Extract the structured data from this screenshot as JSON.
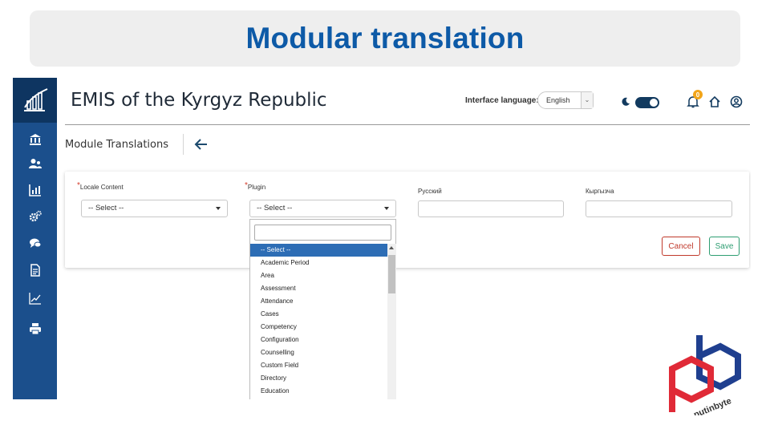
{
  "banner": {
    "title": "Modular translation"
  },
  "app": {
    "title": "EMIS of the Kyrgyz Republic",
    "sidebar": {
      "logo_icon": "bar-chart-logo-icon",
      "items": [
        {
          "icon": "institution-icon"
        },
        {
          "icon": "users-icon"
        },
        {
          "icon": "report-chart-icon"
        },
        {
          "icon": "gears-icon"
        },
        {
          "icon": "chat-icon"
        },
        {
          "icon": "document-icon"
        },
        {
          "icon": "line-chart-icon"
        },
        {
          "icon": "print-icon"
        }
      ]
    },
    "header": {
      "interface_language_label": "Interface language:",
      "interface_language_value": "English",
      "notification_count": "0",
      "icons": [
        "theme-moon-icon",
        "bell-icon",
        "home-icon",
        "user-account-icon"
      ]
    }
  },
  "page": {
    "title": "Module Translations",
    "back_icon": "back-arrow-icon"
  },
  "form": {
    "locale_content": {
      "label": "Locale Content",
      "value": "-- Select --",
      "required": true
    },
    "plugin": {
      "label": "Plugin",
      "value": "-- Select --",
      "required": true
    },
    "russian": {
      "label": "Русский",
      "value": ""
    },
    "kyrgyz": {
      "label": "Кыргызча",
      "value": ""
    },
    "cancel_label": "Cancel",
    "save_label": "Save"
  },
  "dropdown": {
    "search_value": "",
    "options": [
      "-- Select --",
      "Academic Period",
      "Area",
      "Assessment",
      "Attendance",
      "Cases",
      "Competency",
      "Configuration",
      "Counselling",
      "Custom Field",
      "Directory",
      "Education"
    ],
    "selected_index": 0
  },
  "colors": {
    "banner_title": "#0d5aa7",
    "sidebar": "#1b4f8c",
    "selected_option": "#2d6db5",
    "cancel": "#c0392b",
    "save": "#2e9e72"
  }
}
